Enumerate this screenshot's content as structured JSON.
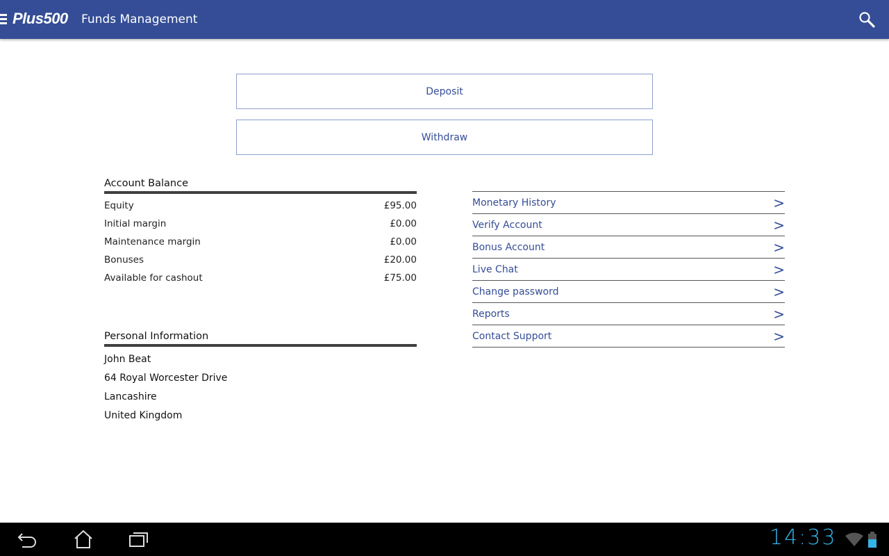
{
  "header": {
    "logo": "Plus500",
    "title": "Funds Management"
  },
  "buttons": {
    "deposit": "Deposit",
    "withdraw": "Withdraw"
  },
  "account_balance": {
    "title": "Account Balance",
    "rows": [
      {
        "label": "Equity",
        "value": "£95.00"
      },
      {
        "label": "Initial margin",
        "value": "£0.00"
      },
      {
        "label": "Maintenance margin",
        "value": "£0.00"
      },
      {
        "label": "Bonuses",
        "value": "£20.00"
      },
      {
        "label": "Available for cashout",
        "value": "£75.00"
      }
    ]
  },
  "personal_info": {
    "title": "Personal Information",
    "lines": [
      "John Beat",
      "64 Royal Worcester Drive",
      "Lancashire",
      "United Kingdom"
    ]
  },
  "links": [
    {
      "label": "Monetary History"
    },
    {
      "label": "Verify Account"
    },
    {
      "label": "Bonus Account"
    },
    {
      "label": "Live Chat"
    },
    {
      "label": "Change password"
    },
    {
      "label": "Reports"
    },
    {
      "label": "Contact Support"
    }
  ],
  "chevron": ">",
  "status": {
    "time": "14:33"
  },
  "colors": {
    "brand": "#344d96",
    "clock": "#33b5e5"
  }
}
